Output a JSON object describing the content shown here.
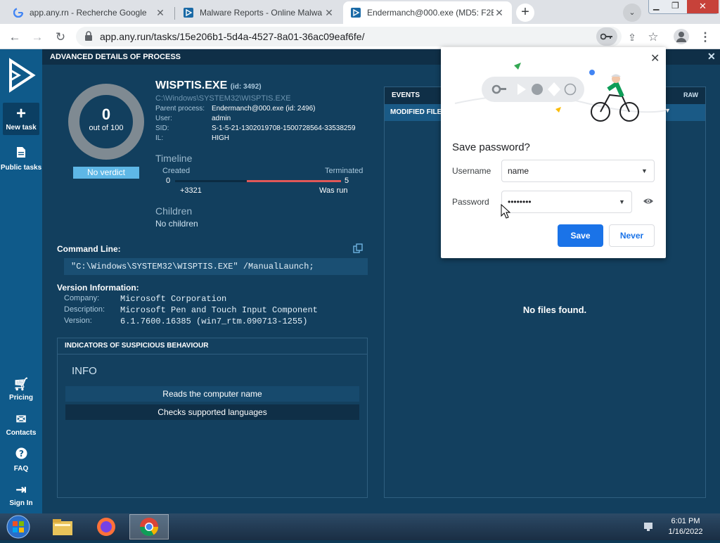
{
  "browser": {
    "tabs": [
      {
        "title": "app.any.rn - Recherche Google",
        "icon": "google-icon",
        "active": false
      },
      {
        "title": "Malware Reports - Online Malwa",
        "icon": "anyrun-icon",
        "active": false
      },
      {
        "title": "Endermanch@000.exe (MD5: F2E",
        "icon": "anyrun-icon",
        "active": true
      }
    ],
    "url": "app.any.run/tasks/15e206b1-5d4a-4527-8a01-36ac09eaf6fe/"
  },
  "sidebar": {
    "items": [
      {
        "label": "New task",
        "icon": "plus-icon"
      },
      {
        "label": "Public tasks",
        "icon": "document-icon"
      },
      {
        "label": "Pricing",
        "icon": "cart-icon"
      },
      {
        "label": "Contacts",
        "icon": "mail-icon"
      },
      {
        "label": "FAQ",
        "icon": "help-icon"
      },
      {
        "label": "Sign In",
        "icon": "signin-icon"
      }
    ]
  },
  "details": {
    "header": "ADVANCED DETAILS OF PROCESS",
    "score": "0",
    "score_sub": "out of 100",
    "verdict": "No verdict",
    "process_name": "WISPTIS.EXE",
    "process_id": "(id: 3492)",
    "process_path": "C:\\Windows\\SYSTEM32\\WISPTIS.EXE",
    "fields": [
      {
        "label": "Parent process:",
        "value": "Endermanch@000.exe (id: 2496)"
      },
      {
        "label": "User:",
        "value": "admin"
      },
      {
        "label": "SID:",
        "value": "S-1-5-21-1302019708-1500728564-33538259"
      },
      {
        "label": "IL:",
        "value": "HIGH"
      }
    ],
    "timeline": {
      "title": "Timeline",
      "created_label": "Created",
      "created_value": "0",
      "created_offset": "+3321",
      "terminated_label": "Terminated",
      "terminated_value": "5",
      "terminated_status": "Was run"
    },
    "children": {
      "title": "Children",
      "value": "No children"
    },
    "command_line": {
      "title": "Command Line:",
      "value": "\"C:\\Windows\\SYSTEM32\\WISPTIS.EXE\" /ManualLaunch;"
    },
    "version": {
      "title": "Version Information:",
      "rows": [
        {
          "label": "Company:",
          "value": "Microsoft Corporation"
        },
        {
          "label": "Description:",
          "value": "Microsoft Pen and Touch Input Component"
        },
        {
          "label": "Version:",
          "value": "6.1.7600.16385 (win7_rtm.090713-1255)"
        }
      ]
    },
    "indicators": {
      "title": "INDICATORS OF SUSPICIOUS BEHAVIOUR",
      "section": "INFO",
      "items": [
        "Reads the computer name",
        "Checks supported languages"
      ]
    }
  },
  "events": {
    "tab_events": "EVENTS",
    "tab_modified": "MODIFIED FILE",
    "raw_label": "RAW",
    "empty": "No files found."
  },
  "password_prompt": {
    "title": "Save password?",
    "username_label": "Username",
    "username_value": "name",
    "password_label": "Password",
    "password_value": "••••••••",
    "save": "Save",
    "never": "Never"
  },
  "taskbar": {
    "time": "6:01 PM",
    "date": "1/16/2022"
  }
}
